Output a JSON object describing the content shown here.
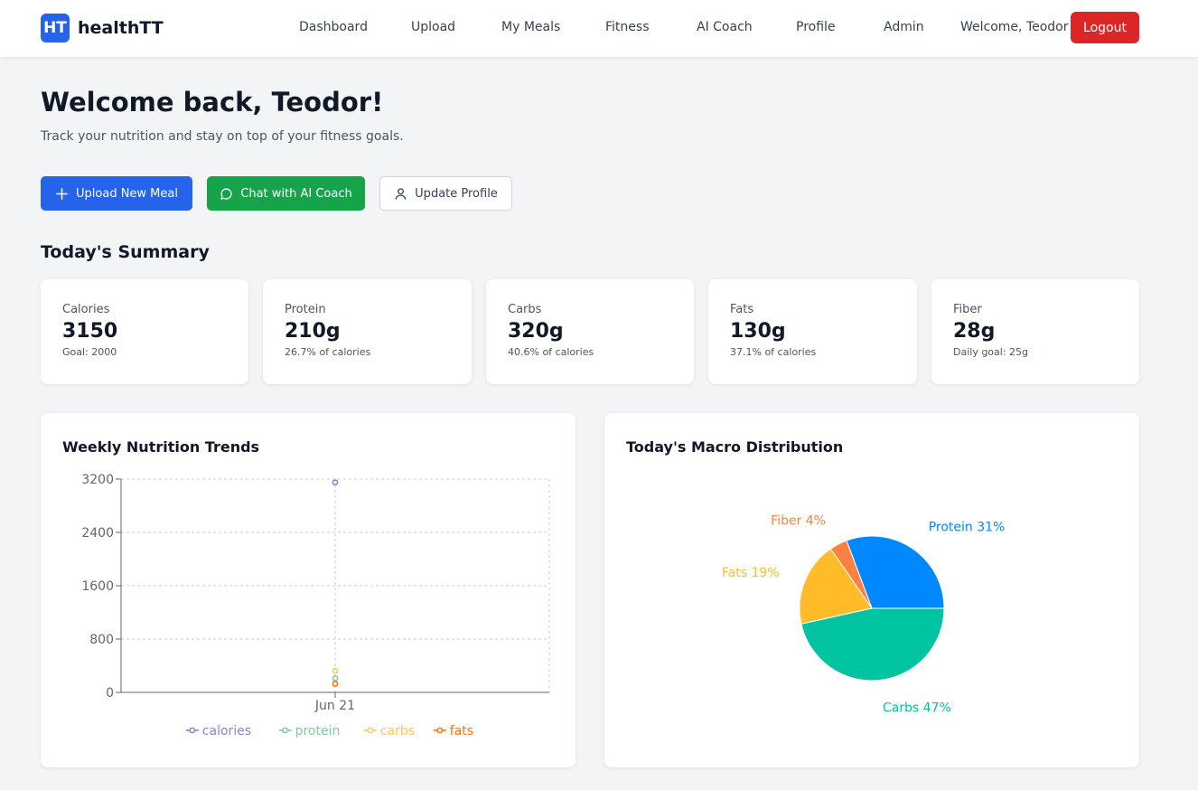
{
  "brand": {
    "logo_text": "HT",
    "name": "healthTT",
    "color": "#2563eb"
  },
  "nav": {
    "links": [
      "Dashboard",
      "Upload",
      "My Meals",
      "Fitness",
      "AI Coach",
      "Profile",
      "Admin"
    ],
    "welcome": "Welcome, Teodor",
    "logout_label": "Logout"
  },
  "header": {
    "title": "Welcome back, Teodor!",
    "subtitle": "Track your nutrition and stay on top of your fitness goals."
  },
  "actions": {
    "upload_label": "Upload New Meal",
    "chat_label": "Chat with AI Coach",
    "profile_label": "Update Profile",
    "upload_icon": "plus-icon",
    "chat_icon": "message-circle-icon",
    "profile_icon": "user-icon"
  },
  "summary": {
    "title": "Today's Summary",
    "cards": [
      {
        "label": "Calories",
        "value": "3150",
        "sub": "Goal: 2000"
      },
      {
        "label": "Protein",
        "value": "210g",
        "sub": "26.7% of calories"
      },
      {
        "label": "Carbs",
        "value": "320g",
        "sub": "40.6% of calories"
      },
      {
        "label": "Fats",
        "value": "130g",
        "sub": "37.1% of calories"
      },
      {
        "label": "Fiber",
        "value": "28g",
        "sub": "Daily goal: 25g"
      }
    ]
  },
  "trends": {
    "title": "Weekly Nutrition Trends"
  },
  "macros": {
    "title": "Today's Macro Distribution"
  },
  "chart_data": [
    {
      "type": "line",
      "title": "Weekly Nutrition Trends",
      "categories": [
        "Jun 21"
      ],
      "ylim": [
        0,
        3200
      ],
      "yticks": [
        0,
        800,
        1600,
        2400,
        3200
      ],
      "grid": true,
      "legend": "bottom",
      "series": [
        {
          "name": "calories",
          "values": [
            3150
          ],
          "color": "#8884d8"
        },
        {
          "name": "protein",
          "values": [
            210
          ],
          "color": "#82ca9d"
        },
        {
          "name": "carbs",
          "values": [
            320
          ],
          "color": "#ffc658"
        },
        {
          "name": "fats",
          "values": [
            130
          ],
          "color": "#ff7300"
        }
      ]
    },
    {
      "type": "pie",
      "title": "Today's Macro Distribution",
      "slices": [
        {
          "name": "Protein",
          "value": 31,
          "label": "Protein 31%",
          "color": "#0088fe"
        },
        {
          "name": "Fiber",
          "value": 4,
          "label": "Fiber 4%",
          "color": "#ff8042"
        },
        {
          "name": "Fats",
          "value": 19,
          "label": "Fats 19%",
          "color": "#ffbb28"
        },
        {
          "name": "Carbs",
          "value": 47,
          "label": "Carbs 47%",
          "color": "#00c49f"
        }
      ]
    }
  ]
}
